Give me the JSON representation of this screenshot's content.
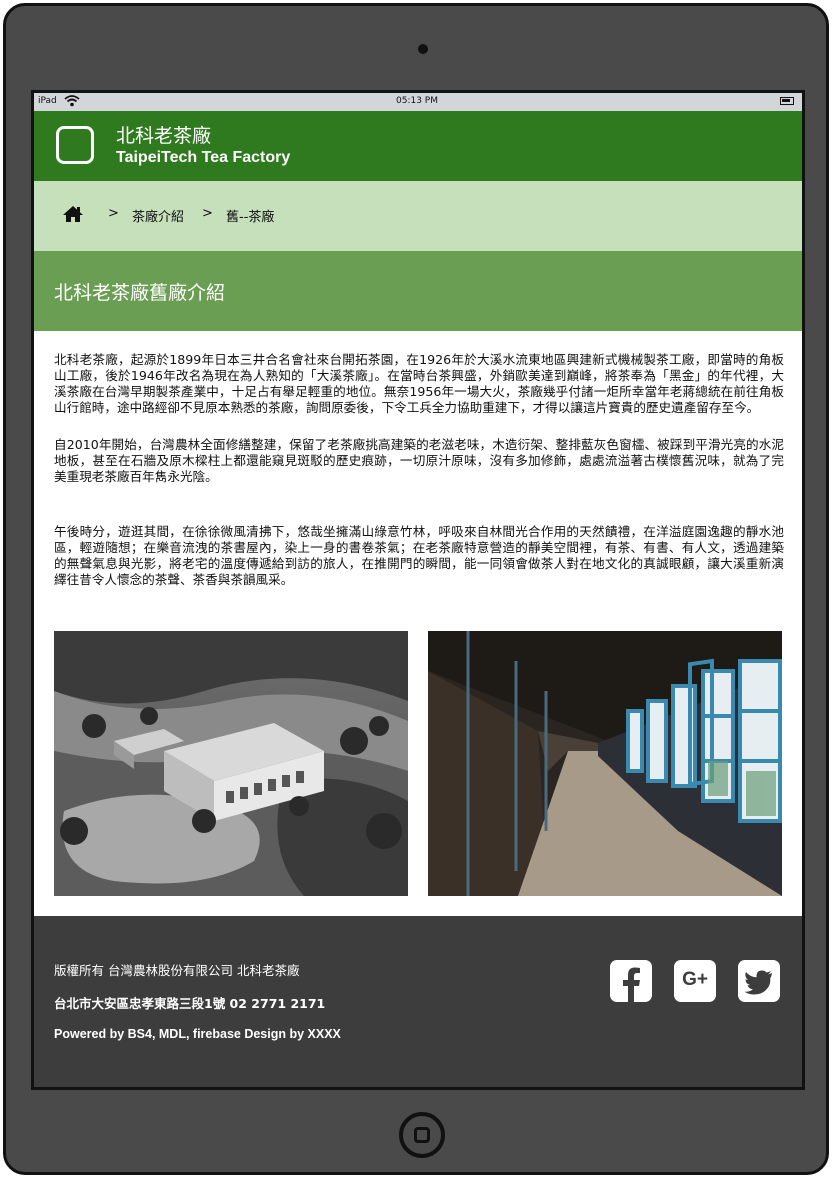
{
  "status_bar": {
    "carrier": "iPad",
    "time": "05:13 PM"
  },
  "app_bar": {
    "title_zh": "北科老茶廠",
    "title_en": "TaipeiTech Tea Factory"
  },
  "breadcrumb": {
    "separator": ">",
    "items": [
      {
        "label": "茶廠介紹"
      },
      {
        "label": "舊--茶廠"
      }
    ]
  },
  "page": {
    "title": "北科老茶廠舊廠介紹"
  },
  "content": {
    "paragraphs": [
      "北科老茶廠，起源於1899年日本三井合名會社來台開拓茶園，在1926年於大溪水流東地區興建新式機械製茶工廠，即當時的角板山工廠，後於1946年改名為現在為人熟知的「大溪茶廠」。在當時台茶興盛，外銷歐美達到巔峰，將茶奉為「黑金」的年代裡，大溪茶廠在台灣早期製茶產業中，十足占有舉足輕重的地位。無奈1956年一場大火，茶廠幾乎付諸一炬所幸當年老蔣總統在前往角板山行館時，途中路經卻不見原本熟悉的茶廠，詢問原委後，下令工兵全力協助重建下，才得以讓這片寶貴的歷史遺產留存至今。",
      "自2010年開始，台灣農林全面修繕整建，保留了老茶廠挑高建築的老滋老味，木造衍架、整排藍灰色窗櫺、被踩到平滑光亮的水泥地板，甚至在石牆及原木樑柱上都還能窺見斑駁的歷史痕跡，一切原汁原味，沒有多加修飾，處處流溢著古樸懷舊況味，就為了完美重現老茶廠百年雋永光陰。",
      "午後時分，遊逛其間，在徐徐微風清拂下，悠哉坐擁滿山綠意竹林，呼吸來自林間光合作用的天然饋禮，在洋溢庭園逸趣的靜水池區，輕遊隨想；在樂音流洩的茶書屋內，染上一身的書卷茶氣；在老茶廠特意營造的靜美空間裡，有茶、有書、有人文，透過建築的無聲氣息與光影，將老宅的溫度傳遞給到訪的旅人，在推開門的瞬間，能一同領會做茶人對在地文化的真誠眼顧，讓大溪重新演繹往昔令人懷念的茶聲、茶香與茶韻風采。"
    ]
  },
  "footer": {
    "copyright": "版權所有 台灣農林股份有限公司 北科老茶廠",
    "address": "台北市大安區忠孝東路三段1號 02 2771 2171",
    "credits": "Powered by BS4, MDL, firebase Design by XXXX"
  },
  "social": [
    "facebook-icon",
    "google-plus-icon",
    "twitter-icon"
  ],
  "colors": {
    "app_bar": "#2f7a1f",
    "breadcrumb": "#c5e0bb",
    "title_bar": "#6a9e52",
    "footer": "#3d3d3d",
    "device_frame": "#4a4a4a"
  }
}
